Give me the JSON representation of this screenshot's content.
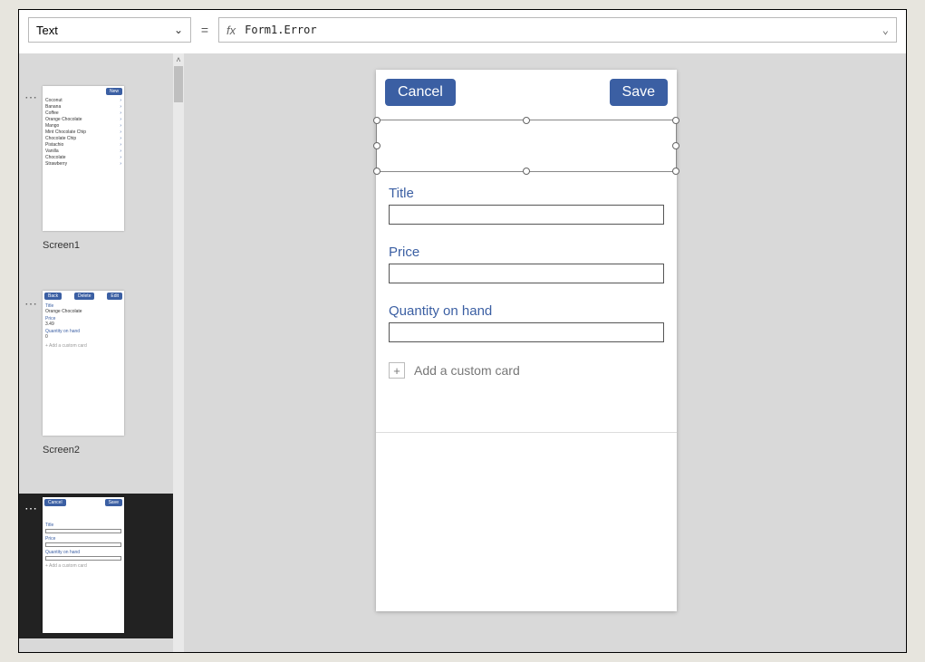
{
  "formulaBar": {
    "property": "Text",
    "fx": "fx",
    "expression": "Form1.Error"
  },
  "thumbnails": {
    "screen1": {
      "label": "Screen1",
      "newBtn": "New",
      "items": [
        "Coconut",
        "Banana",
        "Coffee",
        "Orange Chocolate",
        "Mango",
        "Mint Chocolate Chip",
        "Chocolate Chip",
        "Pistachio",
        "Vanilla",
        "Chocolate",
        "Strawberry"
      ]
    },
    "screen2": {
      "label": "Screen2",
      "backBtn": "Back",
      "deleteBtn": "Delete",
      "editBtn": "Edit",
      "titleLbl": "Title",
      "titleVal": "Orange Chocolate",
      "priceLbl": "Price",
      "priceVal": "3.49",
      "qtyLbl": "Quantity on hand",
      "qtyVal": "0",
      "addCard": "+  Add a custom card"
    },
    "screen3": {
      "cancelBtn": "Cancel",
      "saveBtn": "Save",
      "titleLbl": "Title",
      "priceLbl": "Price",
      "qtyLbl": "Quantity on hand",
      "addCard": "+  Add a custom card"
    }
  },
  "canvas": {
    "cancel": "Cancel",
    "save": "Save",
    "titleLabel": "Title",
    "priceLabel": "Price",
    "qtyLabel": "Quantity on hand",
    "addCard": "Add a custom card"
  }
}
